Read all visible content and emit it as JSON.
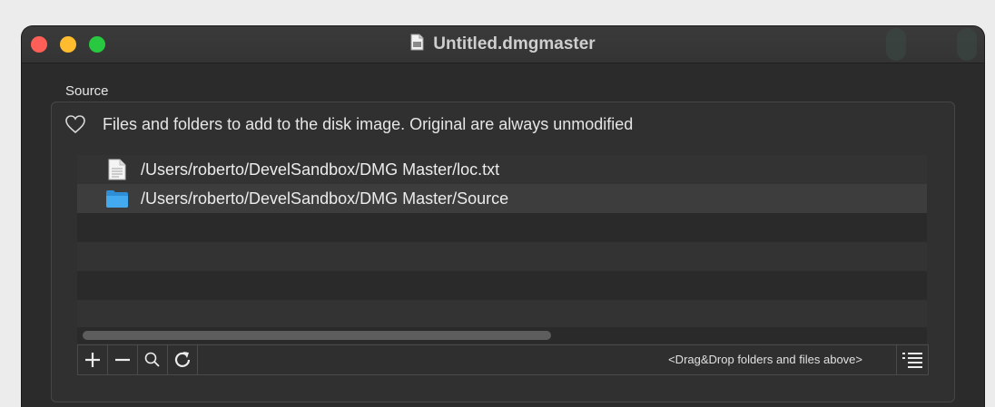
{
  "window": {
    "title": "Untitled.dmgmaster",
    "title_icon": "document-icon",
    "traffic_lights": {
      "close": "#ff5f57",
      "minimize": "#febc2e",
      "zoom": "#28c840"
    }
  },
  "source": {
    "section_label": "Source",
    "description": "Files and folders to add to the disk image. Original are always unmodified",
    "description_icon": "heart-icon",
    "items": [
      {
        "icon": "text-file-icon",
        "path": "/Users/roberto/DevelSandbox/DMG Master/loc.txt",
        "selected": false
      },
      {
        "icon": "folder-icon",
        "path": "/Users/roberto/DevelSandbox/DMG Master/Source",
        "selected": true
      }
    ],
    "toolbar": {
      "add_icon": "plus-icon",
      "remove_icon": "minus-icon",
      "reveal_icon": "magnifier-icon",
      "refresh_icon": "refresh-icon",
      "hint": "<Drag&Drop folders and files above>",
      "options_icon": "list-icon"
    }
  },
  "colors": {
    "window_bg": "#2b2b2b",
    "title_text": "#cfcfcf",
    "text": "#e6e6e6",
    "selection": "#3d3d3d",
    "folder_blue": "#3da0e6"
  }
}
